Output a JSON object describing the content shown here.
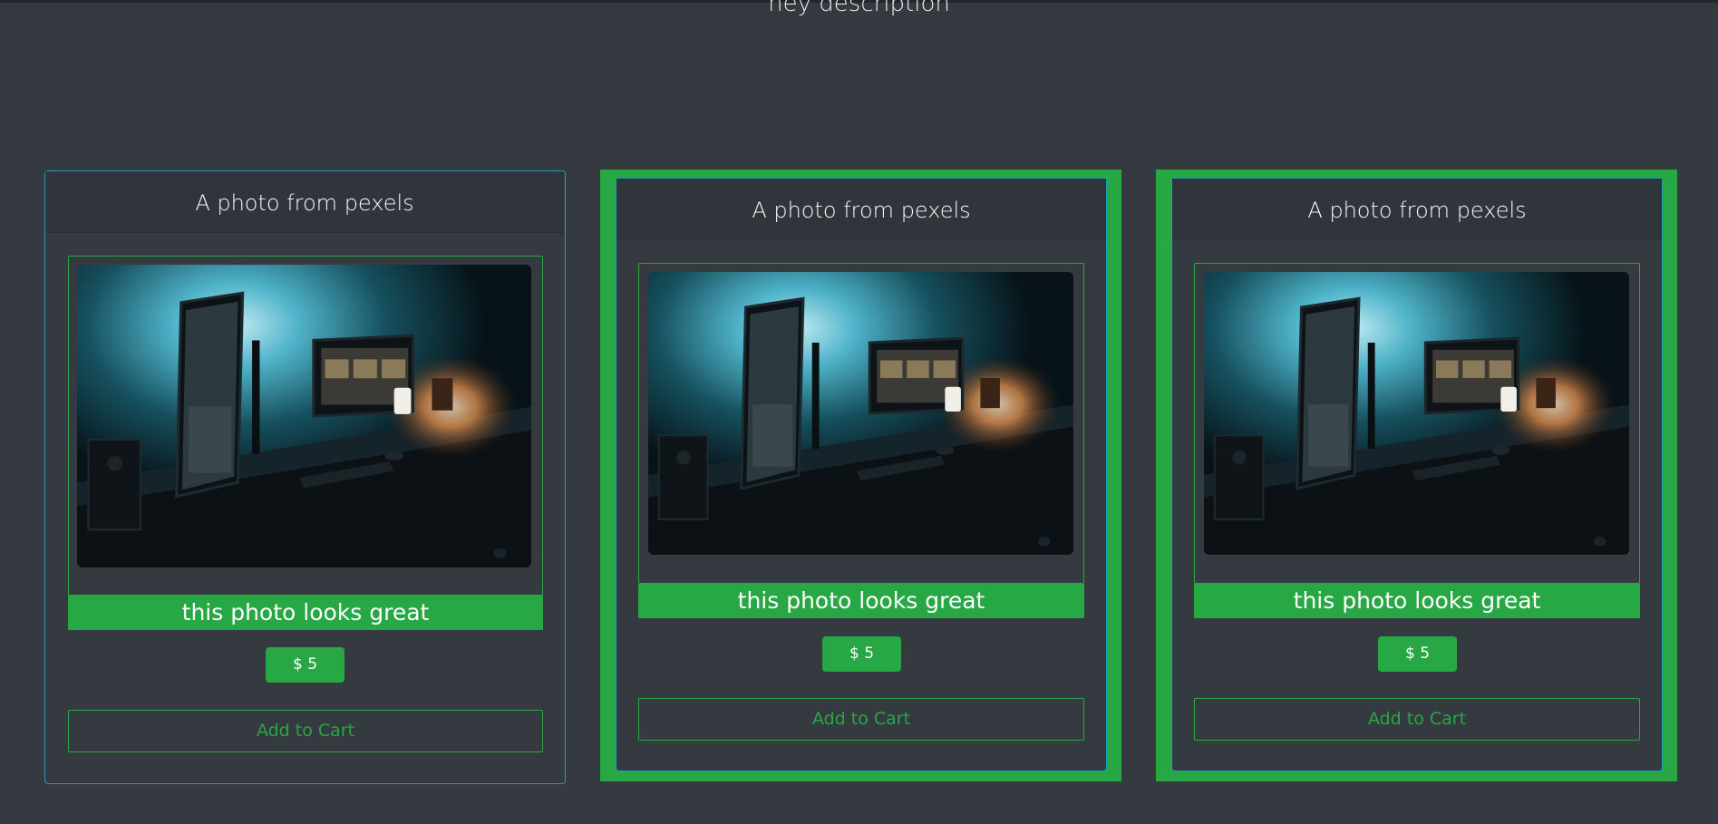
{
  "page": {
    "description": "hey description"
  },
  "colors": {
    "background": "#343a40",
    "accent": "#28a745",
    "border": "#17a2b8"
  },
  "cards": [
    {
      "title": "A photo from pexels",
      "image_alt": "desk setup with monitors",
      "caption": "this photo looks great",
      "price": "$ 5",
      "button": "Add to Cart",
      "featured": false
    },
    {
      "title": "A photo from pexels",
      "image_alt": "desk setup with monitors",
      "caption": "this photo looks great",
      "price": "$ 5",
      "button": "Add to Cart",
      "featured": true
    },
    {
      "title": "A photo from pexels",
      "image_alt": "desk setup with monitors",
      "caption": "this photo looks great",
      "price": "$ 5",
      "button": "Add to Cart",
      "featured": true
    }
  ]
}
